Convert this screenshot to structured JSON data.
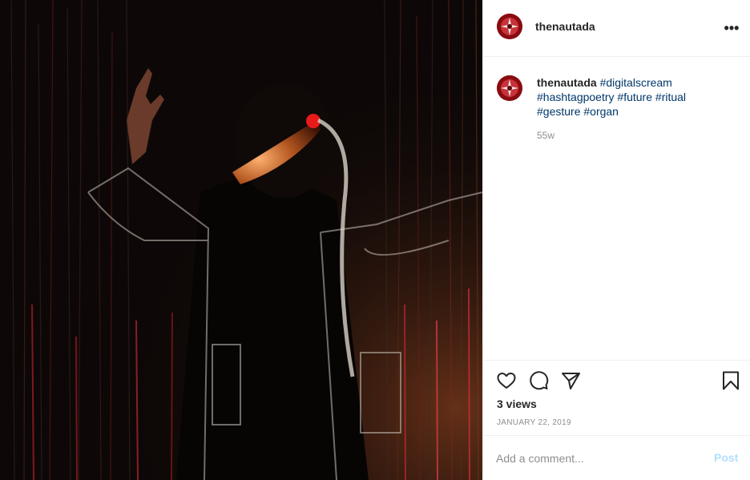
{
  "post": {
    "username": "thenautada",
    "more_icon": "more-horizontal-icon",
    "caption": {
      "username": "thenautada",
      "hashtags": [
        "#digitalscream",
        "#hashtagpoetry",
        "#future",
        "#ritual",
        "#gesture",
        "#organ"
      ],
      "timestamp": "55w"
    },
    "actions": {
      "like_icon": "heart-icon",
      "comment_icon": "comment-icon",
      "share_icon": "paper-plane-icon",
      "save_icon": "bookmark-icon"
    },
    "views": "3 views",
    "date": "JANUARY 22, 2019",
    "comment": {
      "placeholder": "Add a comment...",
      "post_label": "Post"
    }
  },
  "colors": {
    "hashtag": "#00376b",
    "post_button": "#b2dffc",
    "meta_text": "#8e8e8e",
    "divider": "#efefef"
  }
}
